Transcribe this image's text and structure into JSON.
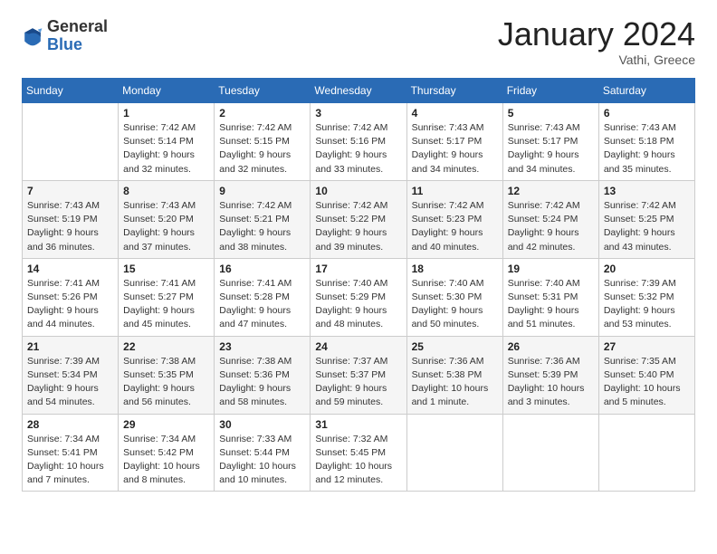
{
  "header": {
    "logo_general": "General",
    "logo_blue": "Blue",
    "month_title": "January 2024",
    "location": "Vathi, Greece"
  },
  "days_of_week": [
    "Sunday",
    "Monday",
    "Tuesday",
    "Wednesday",
    "Thursday",
    "Friday",
    "Saturday"
  ],
  "weeks": [
    [
      {
        "day": "",
        "sunrise": "",
        "sunset": "",
        "daylight": ""
      },
      {
        "day": "1",
        "sunrise": "Sunrise: 7:42 AM",
        "sunset": "Sunset: 5:14 PM",
        "daylight": "Daylight: 9 hours and 32 minutes."
      },
      {
        "day": "2",
        "sunrise": "Sunrise: 7:42 AM",
        "sunset": "Sunset: 5:15 PM",
        "daylight": "Daylight: 9 hours and 32 minutes."
      },
      {
        "day": "3",
        "sunrise": "Sunrise: 7:42 AM",
        "sunset": "Sunset: 5:16 PM",
        "daylight": "Daylight: 9 hours and 33 minutes."
      },
      {
        "day": "4",
        "sunrise": "Sunrise: 7:43 AM",
        "sunset": "Sunset: 5:17 PM",
        "daylight": "Daylight: 9 hours and 34 minutes."
      },
      {
        "day": "5",
        "sunrise": "Sunrise: 7:43 AM",
        "sunset": "Sunset: 5:17 PM",
        "daylight": "Daylight: 9 hours and 34 minutes."
      },
      {
        "day": "6",
        "sunrise": "Sunrise: 7:43 AM",
        "sunset": "Sunset: 5:18 PM",
        "daylight": "Daylight: 9 hours and 35 minutes."
      }
    ],
    [
      {
        "day": "7",
        "sunrise": "Sunrise: 7:43 AM",
        "sunset": "Sunset: 5:19 PM",
        "daylight": "Daylight: 9 hours and 36 minutes."
      },
      {
        "day": "8",
        "sunrise": "Sunrise: 7:43 AM",
        "sunset": "Sunset: 5:20 PM",
        "daylight": "Daylight: 9 hours and 37 minutes."
      },
      {
        "day": "9",
        "sunrise": "Sunrise: 7:42 AM",
        "sunset": "Sunset: 5:21 PM",
        "daylight": "Daylight: 9 hours and 38 minutes."
      },
      {
        "day": "10",
        "sunrise": "Sunrise: 7:42 AM",
        "sunset": "Sunset: 5:22 PM",
        "daylight": "Daylight: 9 hours and 39 minutes."
      },
      {
        "day": "11",
        "sunrise": "Sunrise: 7:42 AM",
        "sunset": "Sunset: 5:23 PM",
        "daylight": "Daylight: 9 hours and 40 minutes."
      },
      {
        "day": "12",
        "sunrise": "Sunrise: 7:42 AM",
        "sunset": "Sunset: 5:24 PM",
        "daylight": "Daylight: 9 hours and 42 minutes."
      },
      {
        "day": "13",
        "sunrise": "Sunrise: 7:42 AM",
        "sunset": "Sunset: 5:25 PM",
        "daylight": "Daylight: 9 hours and 43 minutes."
      }
    ],
    [
      {
        "day": "14",
        "sunrise": "Sunrise: 7:41 AM",
        "sunset": "Sunset: 5:26 PM",
        "daylight": "Daylight: 9 hours and 44 minutes."
      },
      {
        "day": "15",
        "sunrise": "Sunrise: 7:41 AM",
        "sunset": "Sunset: 5:27 PM",
        "daylight": "Daylight: 9 hours and 45 minutes."
      },
      {
        "day": "16",
        "sunrise": "Sunrise: 7:41 AM",
        "sunset": "Sunset: 5:28 PM",
        "daylight": "Daylight: 9 hours and 47 minutes."
      },
      {
        "day": "17",
        "sunrise": "Sunrise: 7:40 AM",
        "sunset": "Sunset: 5:29 PM",
        "daylight": "Daylight: 9 hours and 48 minutes."
      },
      {
        "day": "18",
        "sunrise": "Sunrise: 7:40 AM",
        "sunset": "Sunset: 5:30 PM",
        "daylight": "Daylight: 9 hours and 50 minutes."
      },
      {
        "day": "19",
        "sunrise": "Sunrise: 7:40 AM",
        "sunset": "Sunset: 5:31 PM",
        "daylight": "Daylight: 9 hours and 51 minutes."
      },
      {
        "day": "20",
        "sunrise": "Sunrise: 7:39 AM",
        "sunset": "Sunset: 5:32 PM",
        "daylight": "Daylight: 9 hours and 53 minutes."
      }
    ],
    [
      {
        "day": "21",
        "sunrise": "Sunrise: 7:39 AM",
        "sunset": "Sunset: 5:34 PM",
        "daylight": "Daylight: 9 hours and 54 minutes."
      },
      {
        "day": "22",
        "sunrise": "Sunrise: 7:38 AM",
        "sunset": "Sunset: 5:35 PM",
        "daylight": "Daylight: 9 hours and 56 minutes."
      },
      {
        "day": "23",
        "sunrise": "Sunrise: 7:38 AM",
        "sunset": "Sunset: 5:36 PM",
        "daylight": "Daylight: 9 hours and 58 minutes."
      },
      {
        "day": "24",
        "sunrise": "Sunrise: 7:37 AM",
        "sunset": "Sunset: 5:37 PM",
        "daylight": "Daylight: 9 hours and 59 minutes."
      },
      {
        "day": "25",
        "sunrise": "Sunrise: 7:36 AM",
        "sunset": "Sunset: 5:38 PM",
        "daylight": "Daylight: 10 hours and 1 minute."
      },
      {
        "day": "26",
        "sunrise": "Sunrise: 7:36 AM",
        "sunset": "Sunset: 5:39 PM",
        "daylight": "Daylight: 10 hours and 3 minutes."
      },
      {
        "day": "27",
        "sunrise": "Sunrise: 7:35 AM",
        "sunset": "Sunset: 5:40 PM",
        "daylight": "Daylight: 10 hours and 5 minutes."
      }
    ],
    [
      {
        "day": "28",
        "sunrise": "Sunrise: 7:34 AM",
        "sunset": "Sunset: 5:41 PM",
        "daylight": "Daylight: 10 hours and 7 minutes."
      },
      {
        "day": "29",
        "sunrise": "Sunrise: 7:34 AM",
        "sunset": "Sunset: 5:42 PM",
        "daylight": "Daylight: 10 hours and 8 minutes."
      },
      {
        "day": "30",
        "sunrise": "Sunrise: 7:33 AM",
        "sunset": "Sunset: 5:44 PM",
        "daylight": "Daylight: 10 hours and 10 minutes."
      },
      {
        "day": "31",
        "sunrise": "Sunrise: 7:32 AM",
        "sunset": "Sunset: 5:45 PM",
        "daylight": "Daylight: 10 hours and 12 minutes."
      },
      {
        "day": "",
        "sunrise": "",
        "sunset": "",
        "daylight": ""
      },
      {
        "day": "",
        "sunrise": "",
        "sunset": "",
        "daylight": ""
      },
      {
        "day": "",
        "sunrise": "",
        "sunset": "",
        "daylight": ""
      }
    ]
  ]
}
